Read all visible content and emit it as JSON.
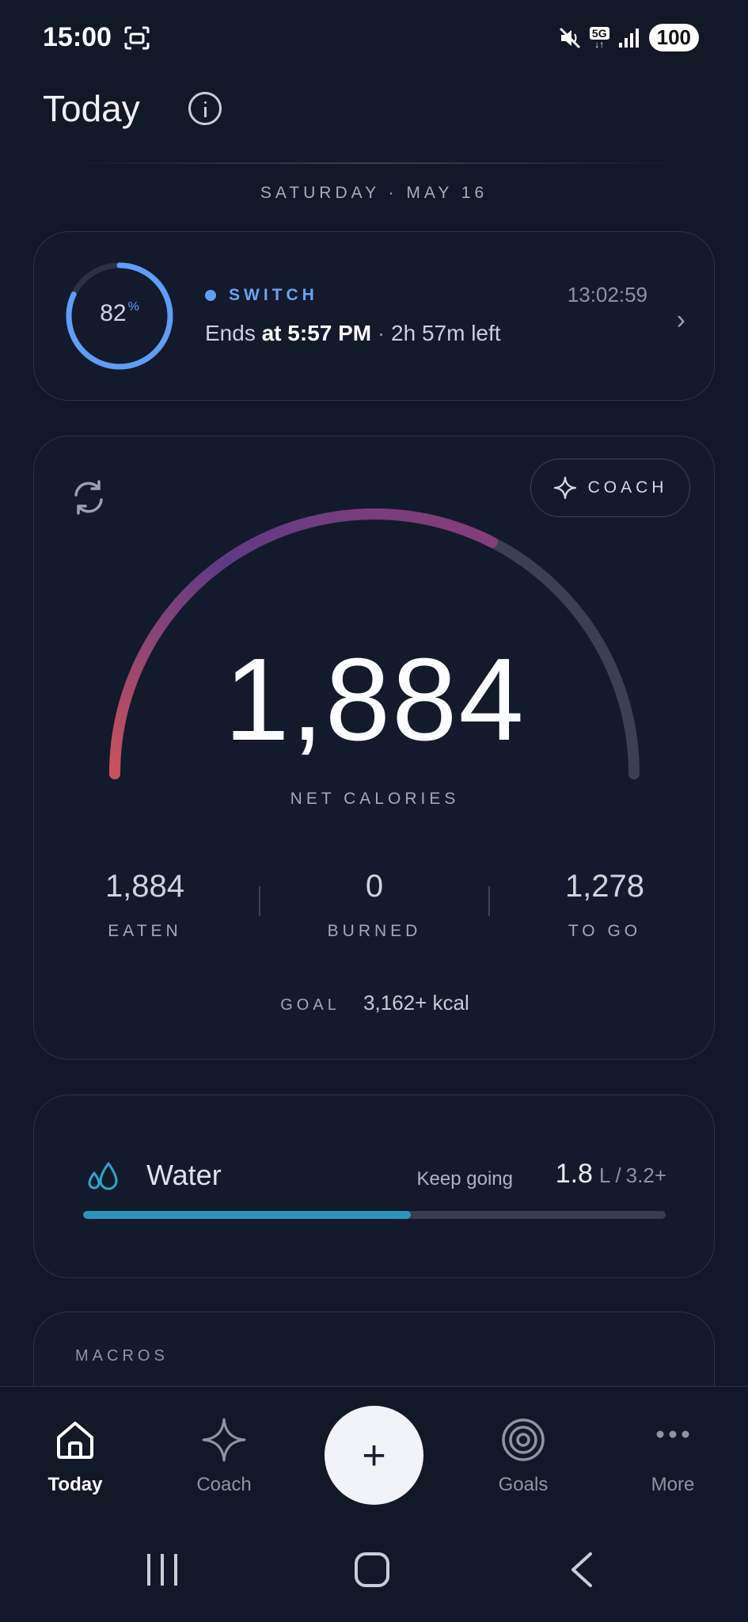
{
  "status_bar": {
    "time": "15:00",
    "network": "5G",
    "battery": "100"
  },
  "page": {
    "title": "Today",
    "date": "SATURDAY · MAY 16"
  },
  "fast": {
    "progress_percent": 82,
    "percent_value": "82",
    "percent_sign": "%",
    "label": "SWITCH",
    "clock": "13:02:59",
    "ends_prefix": "Ends",
    "ends_at_word": "at",
    "ends_time": "5:57 PM",
    "separator": "·",
    "time_left": "2h 57m left"
  },
  "calories": {
    "coach_label": "COACH",
    "net_value": "1,884",
    "net_label": "NET CALORIES",
    "gauge_progress": 0.65,
    "eaten_value": "1,884",
    "eaten_label": "EATEN",
    "burned_value": "0",
    "burned_label": "BURNED",
    "togo_value": "1,278",
    "togo_label": "TO GO",
    "goal_label": "GOAL",
    "goal_value": "3,162+ kcal"
  },
  "water": {
    "title": "Water",
    "status": "Keep going",
    "amount": "1.8",
    "unit": "L",
    "slash": "/",
    "goal": "3.2+",
    "progress": 0.5625
  },
  "macros": {
    "label": "MACROS"
  },
  "nav": {
    "today": "Today",
    "coach": "Coach",
    "goals": "Goals",
    "more": "More"
  },
  "colors": {
    "background": "#111828",
    "accent_blue": "#5f9df7",
    "water": "#2b96b8",
    "gauge_start": "#c9525d",
    "gauge_end": "#6a3a86"
  }
}
